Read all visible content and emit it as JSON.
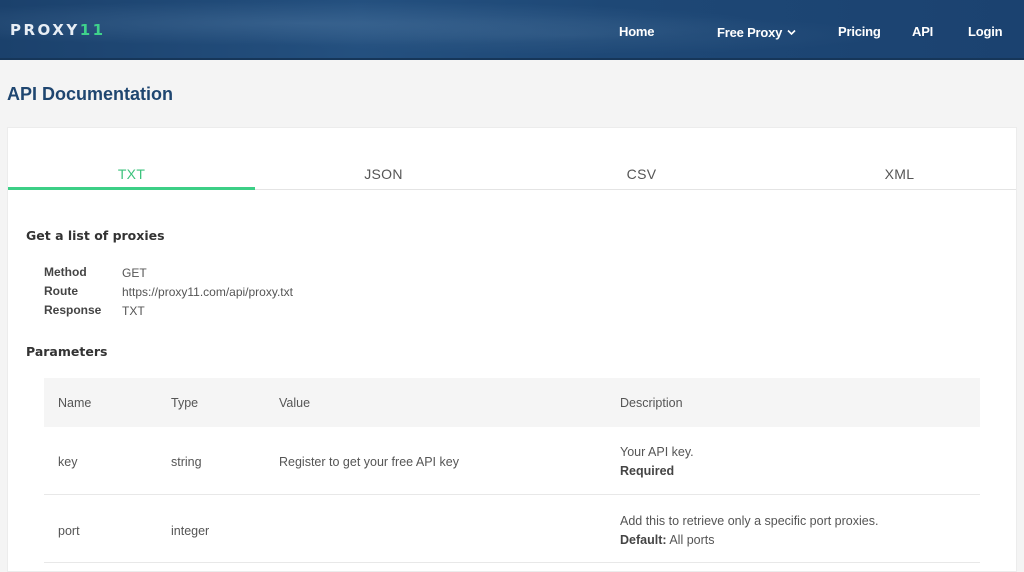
{
  "header": {
    "logo_text": "PROXY",
    "logo_accent": "11",
    "nav": {
      "home": "Home",
      "free_proxy": "Free Proxy",
      "pricing": "Pricing",
      "api": "API",
      "login": "Login"
    }
  },
  "page_title": "API Documentation",
  "tabs": [
    "TXT",
    "JSON",
    "CSV",
    "XML"
  ],
  "active_tab": "TXT",
  "section_list": {
    "heading": "Get a list of proxies",
    "method_label": "Method",
    "method_value": "GET",
    "route_label": "Route",
    "route_value": "https://proxy11.com/api/proxy.txt",
    "response_label": "Response",
    "response_value": "TXT"
  },
  "parameters": {
    "heading": "Parameters",
    "columns": [
      "Name",
      "Type",
      "Value",
      "Description"
    ],
    "rows": [
      {
        "name": "key",
        "type": "string",
        "value": "Register to get your free API key",
        "description": "Your API key.",
        "note_label": "Required",
        "note_value": ""
      },
      {
        "name": "port",
        "type": "integer",
        "value": "",
        "description": "Add this to retrieve only a specific port proxies.",
        "note_label": "Default:",
        "note_value": "All ports"
      }
    ]
  },
  "colors": {
    "navbar": "#1d4572",
    "accent_green": "#3ccf86",
    "title_blue": "#1f4670"
  }
}
